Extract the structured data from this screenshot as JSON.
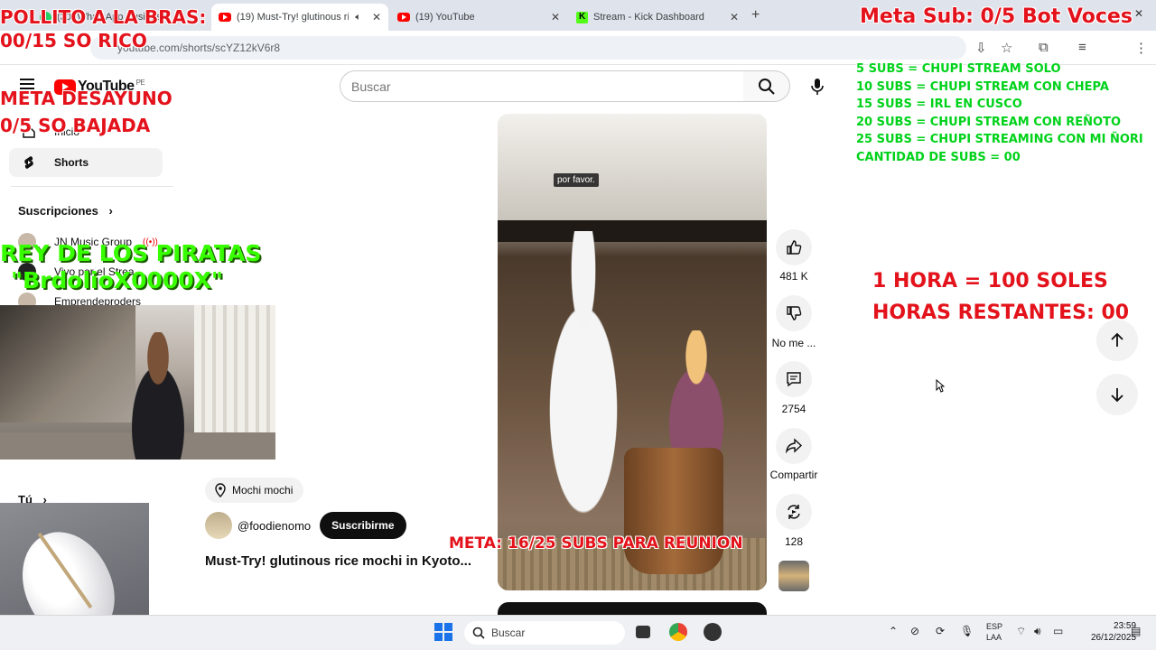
{
  "browser": {
    "tabs": [
      {
        "label": "(30) WhatsApp Business",
        "active": false
      },
      {
        "label": "(19) Must-Try! glutinous ric",
        "active": true
      },
      {
        "label": "(19) YouTube",
        "active": false
      },
      {
        "label": "Stream - Kick Dashboard",
        "active": false
      }
    ],
    "url": "youtube.com/shorts/scYZ12kV6r8"
  },
  "youtube": {
    "logo_text": "YouTube",
    "region": "PE",
    "search_placeholder": "Buscar",
    "sidebar": {
      "items": [
        {
          "label": "Inicio",
          "icon": "home-icon"
        },
        {
          "label": "Shorts",
          "icon": "shorts-icon"
        }
      ],
      "subscriptions_heading": "Suscripciones",
      "channels": [
        {
          "label": "JN Music Group"
        },
        {
          "label": "Vivo por el Strea..."
        },
        {
          "label": "Emprendeproders"
        }
      ],
      "you_heading": "Tú"
    },
    "video": {
      "caption": "por favor.",
      "location": "Mochi mochi",
      "channel_handle": "@foodienomo",
      "subscribe_label": "Suscribirme",
      "title": "Must-Try! glutinous rice mochi in Kyoto..."
    },
    "actions": {
      "likes": "481 K",
      "dislike_label": "No me ...",
      "comments": "2754",
      "share_label": "Compartir",
      "remix_count": "128"
    }
  },
  "overlays": {
    "top_left": [
      "POLLITO A LA BRAS:",
      "00/15 SO RICO"
    ],
    "breakfast": [
      "META DESAYUNO",
      "0/5 SO BAJADA"
    ],
    "king": [
      "REY DE LOS PIRATAS",
      "\"BrdolioX0000X\""
    ],
    "top_right": "Meta Sub: 0/5 Bot Voces",
    "subs_list": [
      "5 SUBS = CHUPI STREAM SOLO",
      "10 SUBS = CHUPI STREAM CON CHEPA",
      "15 SUBS = IRL EN CUSCO",
      "20 SUBS = CHUPI STREAM CON REÑOTO",
      "25 SUBS = CHUPI STREAMING CON MI ÑORI",
      "CANTIDAD DE SUBS = 00"
    ],
    "hours": [
      "1 HORA = 100 SOLES",
      "HORAS RESTANTES: 00"
    ],
    "meta_subs": "META: 16/25 SUBS PARA REUNION"
  },
  "taskbar": {
    "search_label": "Buscar",
    "language": [
      "ESP",
      "LAA"
    ],
    "time": "23:59",
    "date": "26/12/2025"
  },
  "colors": {
    "overlay_red": "#e3121b",
    "overlay_green": "#00d21a",
    "youtube_red": "#ff0000"
  }
}
